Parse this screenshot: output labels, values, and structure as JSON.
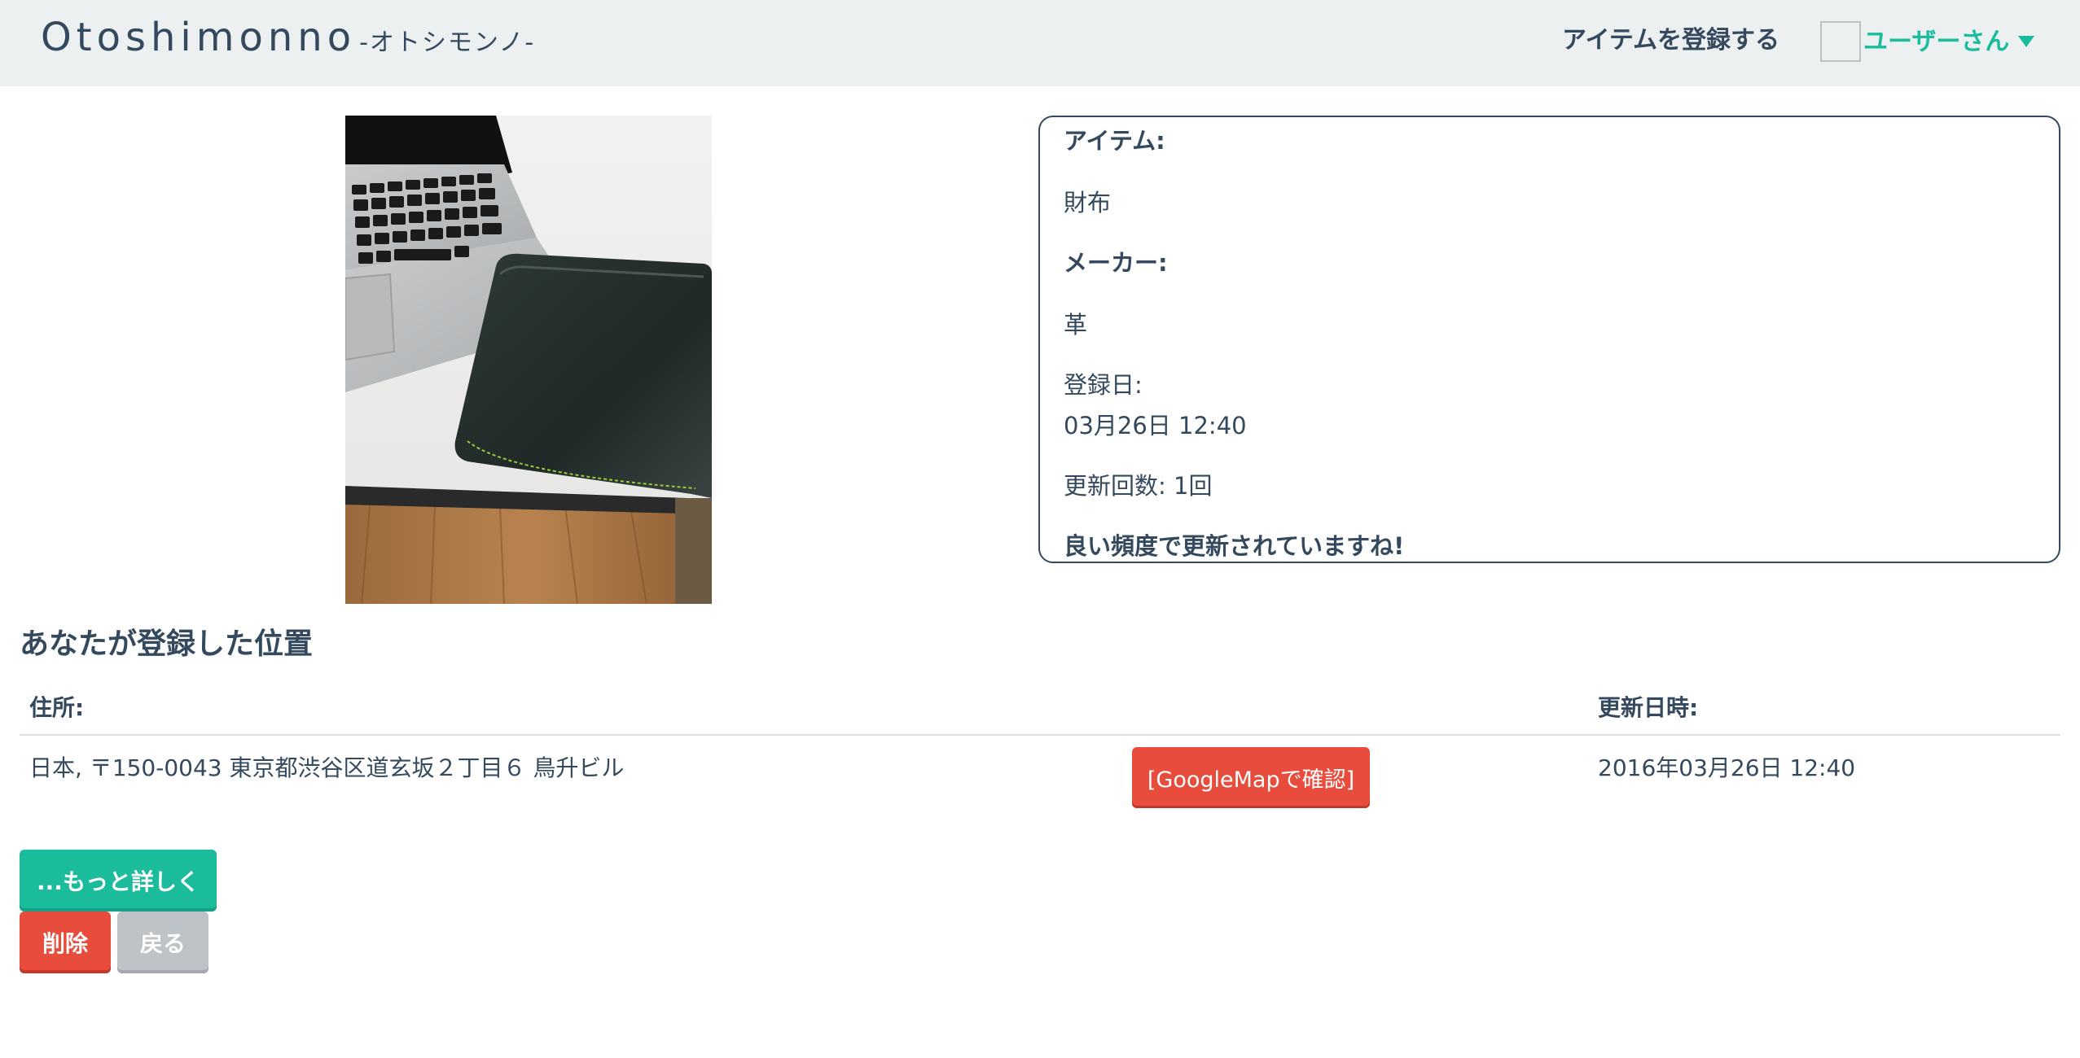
{
  "header": {
    "brand": "Otoshimonno",
    "brand_sub": "-オトシモンノ-",
    "register_link": "アイテムを登録する",
    "user_menu": "ユーザーさん"
  },
  "item": {
    "item_label": "アイテム:",
    "item_value": "財布",
    "maker_label": "メーカー:",
    "maker_value": "革",
    "registered_label": "登録日:",
    "registered_value": "03月26日 12:40",
    "update_count": "更新回数: 1回",
    "message": "良い頻度で更新されていますね!"
  },
  "location": {
    "title": "あなたが登録した位置",
    "headers": {
      "address": "住所:",
      "updated": "更新日時:"
    },
    "rows": [
      {
        "address": "日本, 〒150-0043 東京都渋谷区道玄坂２丁目６ 鳥升ビル",
        "map_button": "[GoogleMapで確認]",
        "updated": "2016年03月26日 12:40"
      }
    ]
  },
  "actions": {
    "more": "...もっと詳しく",
    "delete": "削除",
    "back": "戻る"
  },
  "colors": {
    "primary_text": "#34495e",
    "accent_green": "#1abc9c",
    "danger_red": "#e74c3c",
    "gray_button": "#bdc3c7",
    "navbar_bg": "#ecf0f1"
  },
  "icons": {
    "user_menu_caret": "caret-down-icon",
    "avatar": "user-avatar"
  }
}
